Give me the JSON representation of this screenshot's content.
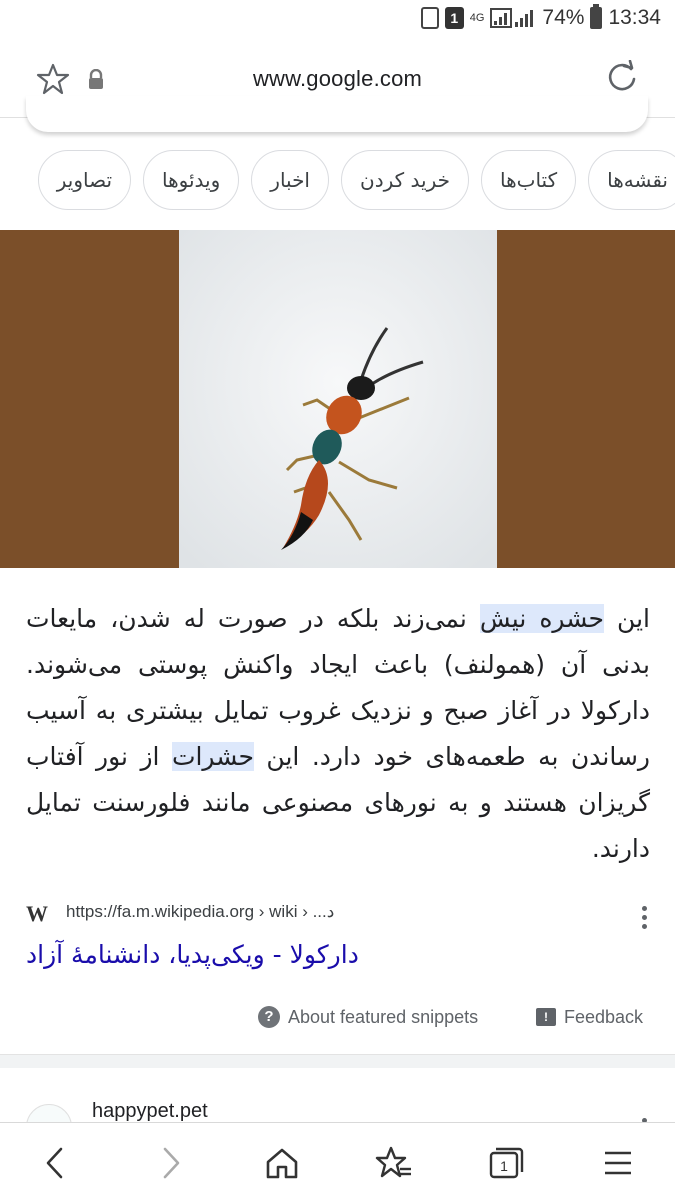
{
  "status_bar": {
    "notification_count": "1",
    "network": "4G",
    "battery": "74%",
    "time": "13:34"
  },
  "browser": {
    "url": "www.google.com",
    "icons": [
      "bookmark-star-icon",
      "lock-icon",
      "reload-icon"
    ]
  },
  "chips": [
    "نقشه‌ها",
    "کتاب‌ها",
    "خرید کردن",
    "اخبار",
    "ویدئوها",
    "تصاویر"
  ],
  "snippet": {
    "part1": "این ",
    "hl1": "حشره نیش",
    "part2": " نمی‌زند بلکه در صورت له شدن، مایعات بدنی آن (همولنف) باعث ایجاد واکنش پوستی می‌شوند. دارکولا در آغاز صبح و نزدیک غروب تمایل بیشتری به آسیب رساندن به طعمه‌های خود دارد. این ",
    "hl2": "حشرات",
    "part3": " از نور آفتاب گریزان هستند و به نورهای مصنوعی مانند فلورسنت تمایل دارند."
  },
  "source": {
    "icon": "W",
    "url": "https://fa.m.wikipedia.org › wiki › ...د"
  },
  "result_title": "دارکولا - ویکی‌پدیا، دانشنامهٔ آزاد",
  "about_snippets": "About featured snippets",
  "feedback": "Feedback",
  "next_result": {
    "site": "happypet.pet"
  },
  "bottom_nav": {
    "tab_count": "1",
    "items": [
      "back-icon",
      "forward-icon",
      "home-icon",
      "bookmarks-icon",
      "tabs-icon",
      "menu-icon"
    ]
  }
}
